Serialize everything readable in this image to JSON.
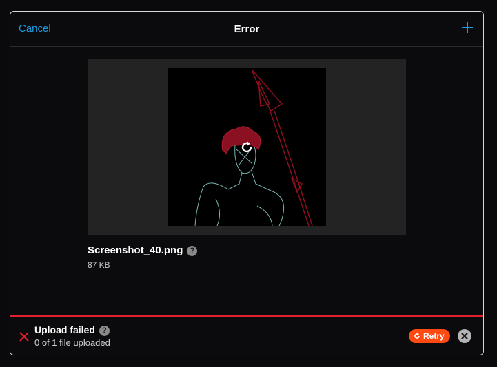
{
  "header": {
    "cancel_label": "Cancel",
    "title": "Error",
    "add_icon": "plus-icon"
  },
  "file": {
    "name": "Screenshot_40.png",
    "size": "87 KB",
    "help_icon": "question-mark",
    "preview_overlay_icon": "retry-icon"
  },
  "status": {
    "title": "Upload failed",
    "subtitle": "0 of 1 file uploaded",
    "retry_label": "Retry",
    "error_icon": "x-icon",
    "close_icon": "close-icon",
    "help_icon_glyph": "?"
  },
  "colors": {
    "accent": "#1e9bde",
    "error": "#e0202c",
    "retry": "#ff4a14"
  }
}
